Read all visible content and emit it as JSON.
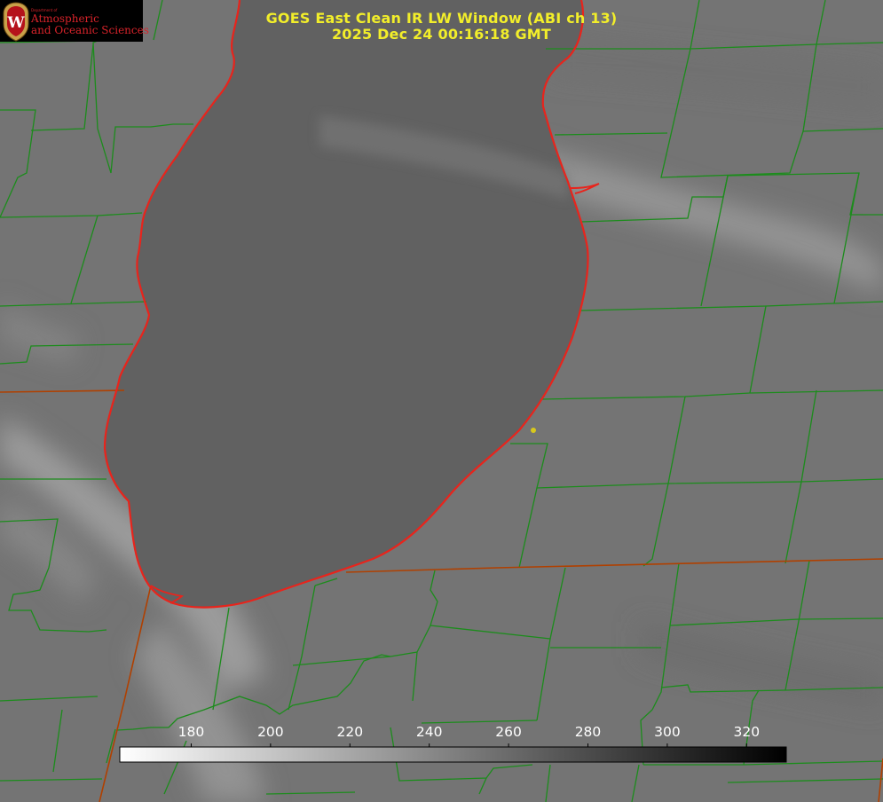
{
  "title": {
    "line1": "GOES East Clean IR LW Window (ABI ch 13)",
    "line2": "2025 Dec 24 00:16:18 GMT"
  },
  "logo": {
    "small_text": "Department of",
    "line1": "Atmospheric",
    "line2": "and Oceanic Sciences",
    "emblem_icon": "uw-crest-icon"
  },
  "colorbar": {
    "min": 162,
    "max": 330,
    "ticks": [
      180,
      200,
      220,
      240,
      260,
      280,
      300,
      320
    ],
    "tick_labels": [
      "180",
      "200",
      "220",
      "240",
      "260",
      "280",
      "300",
      "320"
    ],
    "color_low": "#ffffff",
    "color_high": "#000000"
  },
  "colors": {
    "title": "#f2ee2a",
    "county_lines": "#1c8c1c",
    "state_lines": "#b04000",
    "lake_shore": "#e8241c",
    "land_background": "#727272",
    "lake_fill": "#5f5f5f",
    "marker": "#d8c81c",
    "logo_text": "#d8232a"
  },
  "map": {
    "marker_icon": "city-dot-icon"
  }
}
